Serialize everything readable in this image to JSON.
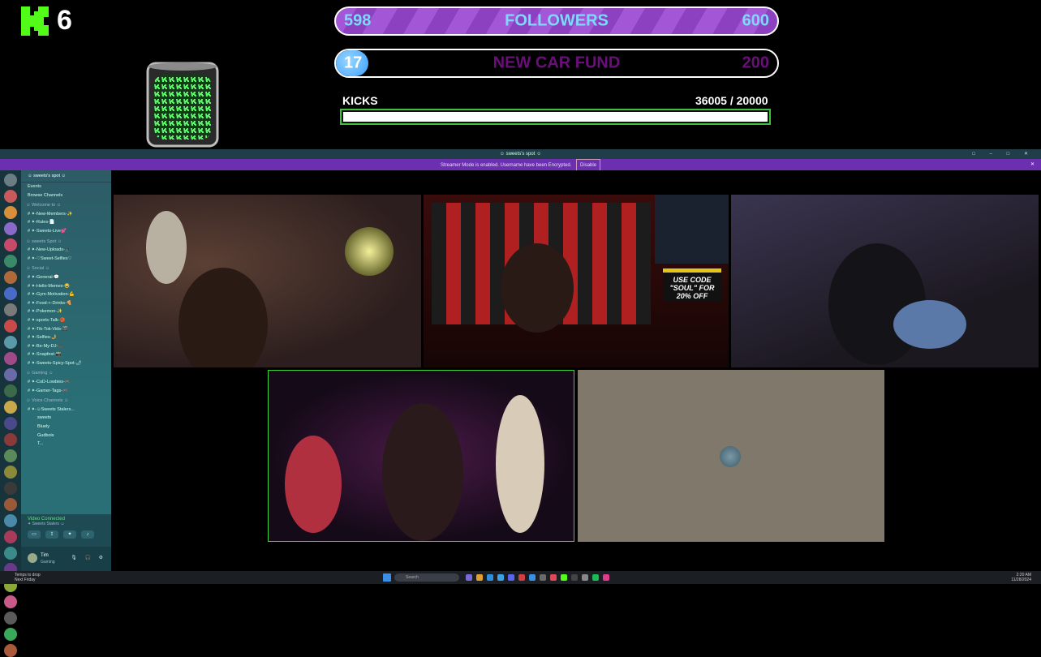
{
  "overlay": {
    "logo_count": "6",
    "followers_goal": {
      "current": "598",
      "label": "FOLLOWERS",
      "target": "600",
      "color": "#a357d6"
    },
    "car_fund_goal": {
      "current": "17",
      "label": "NEW CAR FUND",
      "target": "200",
      "label_color": "#6a0f7a"
    },
    "kicks": {
      "label": "KICKS",
      "value": "36005  / 20000",
      "progress": 1.0
    }
  },
  "window": {
    "title": "☺ sweets's spot ☺",
    "notice_text": "Streamer Mode is enabled. Username have been Encrypted.",
    "notice_button": "Disable",
    "controls": "□ – □ ✕"
  },
  "sidebar": {
    "server_name": "☺ sweets's spot ☺",
    "top_items": [
      "Events",
      "Browse Channels"
    ],
    "categories": [
      {
        "name": "☺ Welcome to ☺",
        "channels": [
          "✦-New-Members-✨",
          "✦-Rules-📄",
          "✦-Sweets-Live💕"
        ]
      },
      {
        "name": "☺ sweets Spot ☺",
        "channels": [
          "✦-New-Uploads-📺",
          "✦-♡Sweet-Selfies♡"
        ]
      },
      {
        "name": "☺ Social ☺",
        "channels": [
          "✦-General-💬",
          "✦-Hello-Memes-😂",
          "✦-Gym-Motivation-💪",
          "✦-Food-+-Drinks-🍕",
          "✦-Pokemon-✨",
          "✦-sports-Talk-🏀",
          "✦-Tik-Tok-Vids-🎬",
          "✦-Selfies-🤳",
          "✦-Be-My-DJ-🎧",
          "✦-Snapfest-📸",
          "✦-Sweets-Spicy-Spot-🌶"
        ]
      },
      {
        "name": "☺ Gaming ☺",
        "channels": [
          "✦-CoD-Lowbies-🎮",
          "✦-Gamer-Tags-🎮"
        ]
      },
      {
        "name": "☺ Voice Channels ☺",
        "channels": [
          "✦-☺Sweets Stalers..."
        ]
      }
    ],
    "voice_members": [
      "sweets",
      "Bluely",
      "Gudbois",
      "T..."
    ],
    "voice_connected": {
      "title": "Video Connected",
      "subtitle": "✦ Sweets Stalers ☺"
    },
    "user": {
      "name": "Tim",
      "status": "Gaming"
    }
  },
  "stage": {
    "promo_text": "USE CODE \"SOUL\" FOR 20% OFF",
    "promo_accent": "#e4c51a"
  },
  "taskbar": {
    "weather_title": "Temps to drop",
    "weather_sub": "Next Friday",
    "search_placeholder": "Search",
    "time": "2:20 AM",
    "date": "11/28/2024"
  }
}
